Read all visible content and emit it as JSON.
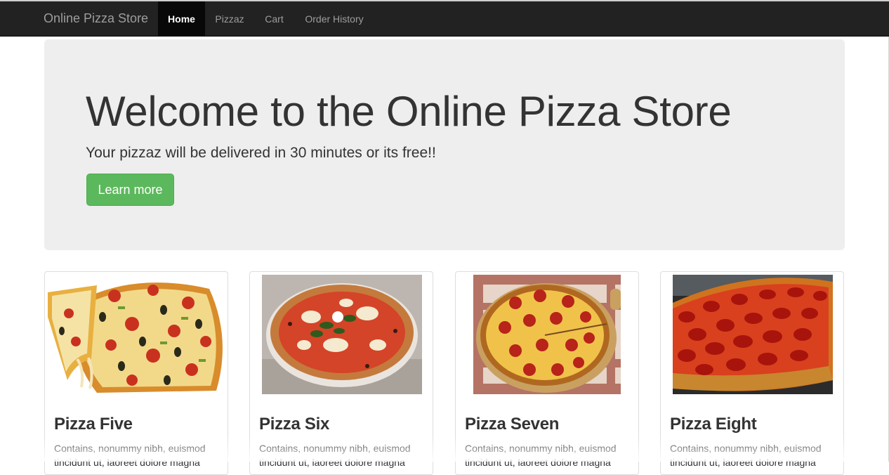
{
  "navbar": {
    "brand": "Online Pizza Store",
    "items": [
      {
        "label": "Home",
        "active": true
      },
      {
        "label": "Pizzaz",
        "active": false
      },
      {
        "label": "Cart",
        "active": false
      },
      {
        "label": "Order History",
        "active": false
      }
    ]
  },
  "jumbotron": {
    "title": "Welcome to the Online Pizza Store",
    "subtitle": "Your pizzaz will be delivered in 30 minutes or its free!!",
    "button_label": "Learn more"
  },
  "pizzas": [
    {
      "name": "Pizza Five",
      "description_line1": "Contains, nonummy nibh, euismod",
      "description_line2": "tincidunt ut, laoreet dolore magna",
      "image": "pizza-slice-photo"
    },
    {
      "name": "Pizza Six",
      "description_line1": "Contains, nonummy nibh, euismod",
      "description_line2": "tincidunt ut, laoreet dolore magna",
      "image": "margherita-pizza-photo"
    },
    {
      "name": "Pizza Seven",
      "description_line1": "Contains, nonummy nibh, euismod",
      "description_line2": "tincidunt ut, laoreet dolore magna",
      "image": "pepperoni-board-photo"
    },
    {
      "name": "Pizza Eight",
      "description_line1": "Contains, nonummy nibh, euismod",
      "description_line2": "tincidunt ut, laoreet dolore magna",
      "image": "pepperoni-closeup-photo"
    }
  ],
  "colors": {
    "navbar_bg": "#222222",
    "jumbotron_bg": "#eeeeee",
    "button_success": "#5cb85c"
  }
}
